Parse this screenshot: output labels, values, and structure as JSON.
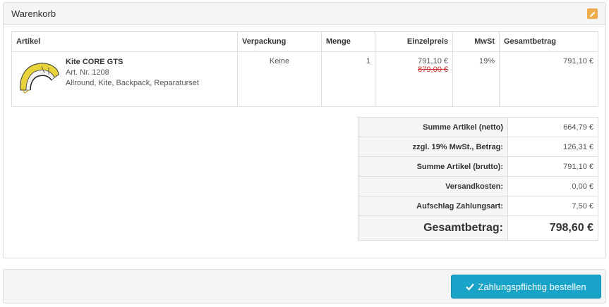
{
  "panel": {
    "title": "Warenkorb",
    "edit_icon": "pencil-icon",
    "accent_color": "#f0ad4e"
  },
  "cart": {
    "columns": {
      "article": "Artikel",
      "packaging": "Verpackung",
      "quantity": "Menge",
      "unit_price": "Einzelpreis",
      "vat": "MwSt",
      "total": "Gesamtbetrag"
    },
    "items": [
      {
        "name": "Kite CORE GTS",
        "article_no": "Art. Nr. 1208",
        "description": "Allround, Kite, Backpack, Reparaturset",
        "packaging": "Keine",
        "quantity": "1",
        "unit_price": "791,10 €",
        "old_price": "879,00 €",
        "vat": "19%",
        "total": "791,10 €"
      }
    ]
  },
  "totals": {
    "rows": [
      {
        "label": "Summe Artikel (netto)",
        "value": "664,79 €"
      },
      {
        "label": "zzgl. 19% MwSt., Betrag:",
        "value": "126,31 €"
      },
      {
        "label": "Summe Artikel (brutto):",
        "value": "791,10 €"
      },
      {
        "label": "Versandkosten:",
        "value": "0,00 €"
      },
      {
        "label": "Aufschlag Zahlungsart:",
        "value": "7,50 €"
      }
    ],
    "grand_label": "Gesamtbetrag:",
    "grand_value": "798,60 €"
  },
  "footer": {
    "order_button_label": "Zahlungspflichtig bestellen",
    "order_button_icon": "checkmark-icon",
    "button_color": "#1aa3c8"
  }
}
